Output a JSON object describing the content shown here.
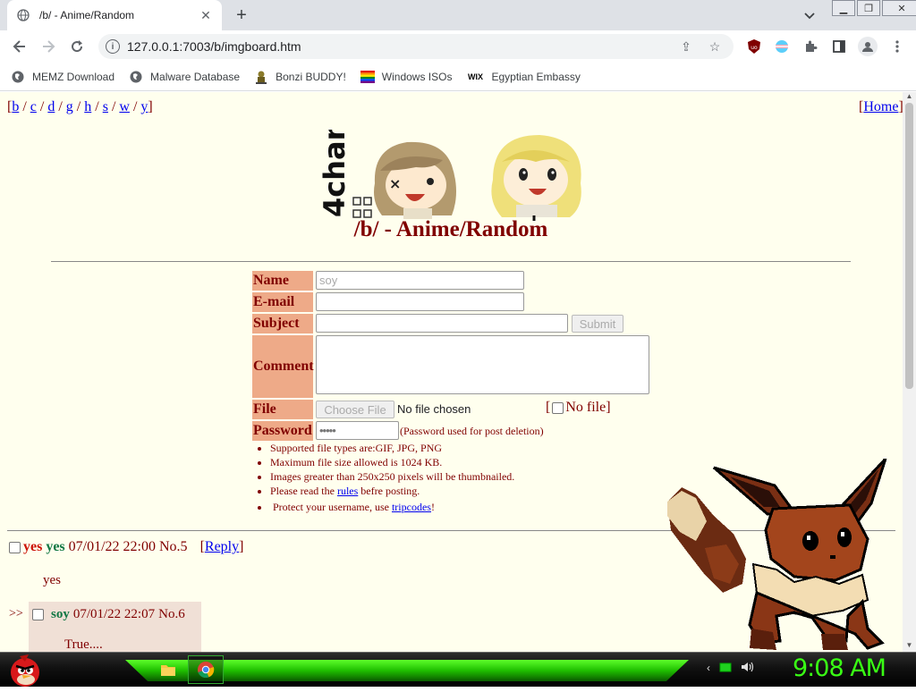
{
  "browser": {
    "tab": {
      "title": "/b/ - Anime/Random",
      "close_icon": "close-icon"
    },
    "new_tab_icon": "plus-icon",
    "toolbar": {
      "url": "127.0.0.1:7003/b/imgboard.htm",
      "icons": [
        "back-icon",
        "forward-icon",
        "reload-icon",
        "info-icon",
        "share-icon",
        "star-icon",
        "ublock-icon",
        "extension-icon",
        "puzzle-icon",
        "sidepanel-icon",
        "profile-icon",
        "menu-icon"
      ]
    },
    "bookmarks": [
      {
        "label": "MEMZ Download"
      },
      {
        "label": "Malware Database"
      },
      {
        "label": "Bonzi BUDDY!"
      },
      {
        "label": "Windows ISOs"
      },
      {
        "label": "Egyptian Embassy",
        "badge": "WIX"
      }
    ]
  },
  "page": {
    "boards": [
      "b",
      "c",
      "d",
      "g",
      "h",
      "s",
      "w",
      "y"
    ],
    "home_link": "Home",
    "logo_text": "4chan",
    "title": "/b/ - Anime/Random",
    "form": {
      "name_label": "Name",
      "name_value": "soy",
      "email_label": "E-mail",
      "subject_label": "Subject",
      "submit_label": "Submit",
      "comment_label": "Comment",
      "file_label": "File",
      "choose_file_label": "Choose File",
      "no_file_chosen": "No file chosen",
      "no_file_checkbox_label": "No file]",
      "password_label": "Password",
      "password_value": "•••••",
      "password_note": "(Password used for post deletion)"
    },
    "rules": {
      "items": [
        "Supported file types are:GIF, JPG, PNG",
        "Maximum file size allowed is 1024 KB.",
        "Images greater than 250x250 pixels will be thumbnailed."
      ],
      "read_prefix": "Please read the ",
      "rules_link": "rules",
      "read_suffix": " befre posting.",
      "protect_prefix": "Protect your username, use ",
      "tripcodes_link": "tripcodes",
      "protect_suffix": "!"
    },
    "posts": [
      {
        "subject": "yes",
        "name": "yes",
        "datetime": "07/01/22 22:00",
        "number": "No.5",
        "reply_link": "Reply",
        "message": "yes"
      }
    ],
    "replies": [
      {
        "arrow": ">>",
        "name": "soy",
        "datetime": "07/01/22 22:07",
        "number": "No.6",
        "message": "True...."
      }
    ]
  },
  "taskbar": {
    "clock": "9:08 AM",
    "apps": [
      "folder-icon",
      "chrome-icon"
    ],
    "tray_icons": [
      "chevron-left-icon",
      "battery-icon",
      "volume-icon"
    ],
    "colors": {
      "accent": "#39ff14",
      "glow": "#1fbf00"
    }
  }
}
